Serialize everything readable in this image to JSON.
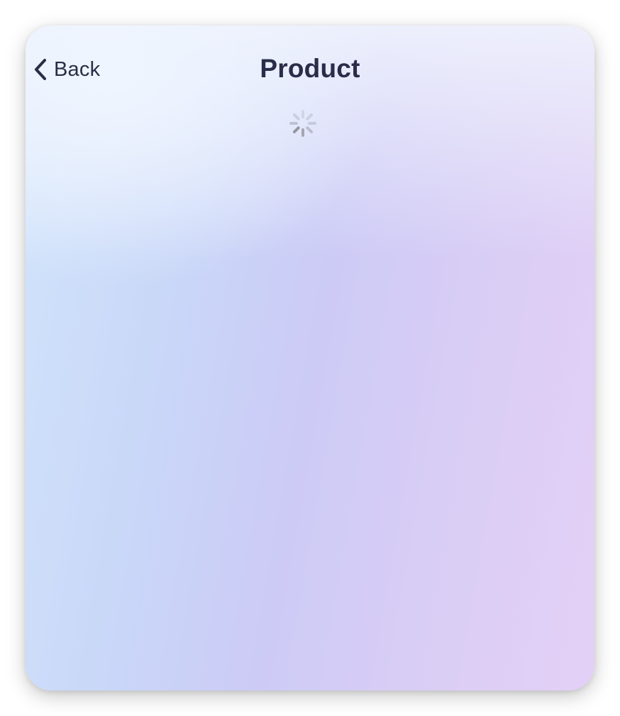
{
  "nav": {
    "back_label": "Back",
    "back_icon": "chevron-left-icon",
    "title": "Product"
  },
  "content": {
    "state": "loading",
    "spinner_icon": "loading-spinner-icon"
  },
  "colors": {
    "title": "#2a2c48",
    "back": "#2b2d45",
    "spinner": "#8c8c95",
    "gradient_left": "#d0e4fb",
    "gradient_mid": "#cccbf6",
    "gradient_right": "#e4d0f6"
  }
}
